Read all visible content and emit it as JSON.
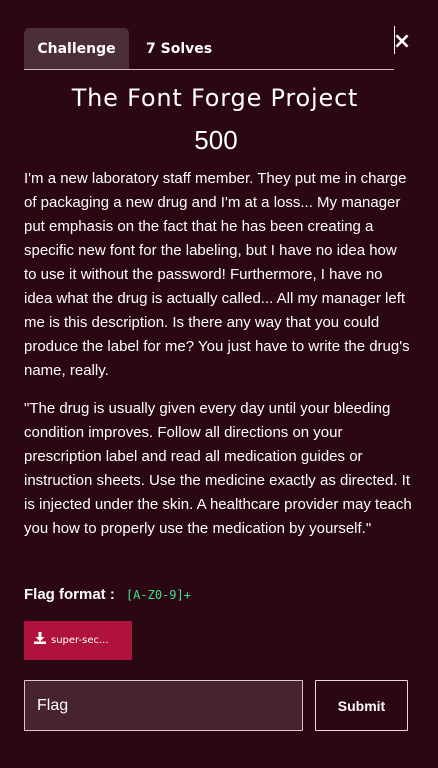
{
  "modal": {
    "close_glyph": "×",
    "tabs": [
      {
        "label": "Challenge",
        "active": true
      },
      {
        "label": "7 Solves",
        "active": false
      }
    ],
    "title": "The Font Forge Project",
    "value": "500",
    "description": "I'm a new laboratory staff member. They put me in charge of packaging a new drug and I'm at a loss... My manager put emphasis on the fact that he has been creating a specific new font for the labeling, but I have no idea how to use it without the password! Furthermore, I have no idea what the drug is actually called... All my manager left me is this description. Is there any way that you could produce the label for me? You just have to write the drug's name, really.",
    "quote": "\"The drug is usually given every day until your bleeding condition improves. Follow all directions on your prescription label and read all medication guides or instruction sheets. Use the medicine exactly as directed. It is injected under the skin. A healthcare provider may teach you how to properly use the medication by yourself.\"",
    "flag_format_label": "Flag format :",
    "flag_format_value": "[A-Z0-9]+",
    "file_button": {
      "label": "super-sec...",
      "icon": "download-icon"
    },
    "flag_input": {
      "placeholder": "Flag",
      "value": ""
    },
    "submit_label": "Submit"
  },
  "colors": {
    "background": "#2a0713",
    "active_tab": "#4b2e37",
    "file_button": "#b0123e",
    "input_background": "#46232d",
    "code_green": "#3fe08a"
  }
}
